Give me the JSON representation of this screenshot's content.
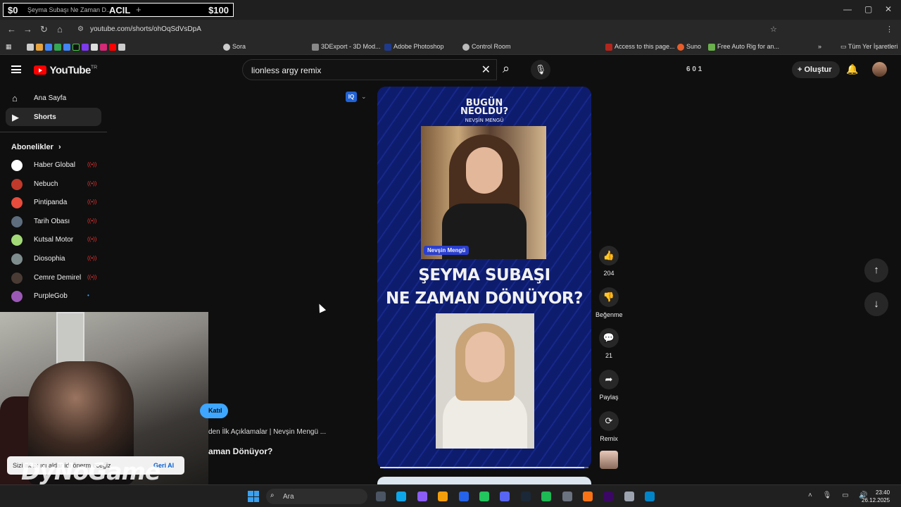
{
  "overlay_bar": {
    "left": "$0",
    "center": "ACIL",
    "right": "$100",
    "tab_title": "Şeyma Subaşı Ne Zaman D...",
    "new_tab": "+"
  },
  "window_controls": {
    "minimize": "—",
    "maximize": "▢",
    "close": "✕"
  },
  "address": {
    "url": "youtube.com/shorts/ohOqSdVsDpA",
    "back": "←",
    "forward": "→",
    "reload": "↻",
    "home": "⌂"
  },
  "bookmarks": {
    "items": [
      {
        "label": "Sora",
        "color": "#cccccc"
      },
      {
        "label": "3DExport - 3D Mod...",
        "color": "#888888"
      },
      {
        "label": "Adobe Photoshop",
        "color": "#1f3a8a"
      },
      {
        "label": "Control Room",
        "color": "#bbbbbb"
      },
      {
        "label": "Access to this page...",
        "color": "#b3261e"
      },
      {
        "label": "Suno",
        "color": "#e85d2a"
      },
      {
        "label": "Free Auto Rig for an...",
        "color": "#6ab04c"
      }
    ],
    "all_bookmarks": "Tüm Yer İşaretleri",
    "more": "»"
  },
  "header": {
    "logo": "YouTube",
    "logo_country": "TR",
    "search_value": "lionless argy remix",
    "clear": "✕",
    "search_icon": "⌕",
    "mic_icon": "🎙",
    "counters": "6   0   1",
    "create_label": "Oluştur",
    "create_plus": "+",
    "bell": "🔔"
  },
  "sidebar": {
    "home": {
      "label": "Ana Sayfa",
      "icon": "⌂"
    },
    "shorts": {
      "label": "Shorts",
      "icon": "▶"
    },
    "subscriptions_title": "Abonelikler",
    "subscriptions_chevron": "›",
    "subscriptions": [
      {
        "name": "Haber Global",
        "live": "((•))",
        "color": "#ffffff"
      },
      {
        "name": "Nebuch",
        "live": "((•))",
        "color": "#c0392b"
      },
      {
        "name": "Pintipanda",
        "live": "((•))",
        "color": "#e74c3c"
      },
      {
        "name": "Tarih Obası",
        "live": "((•))",
        "color": "#5d6d7e"
      },
      {
        "name": "Kutsal Motor",
        "live": "((•))",
        "color": "#a3d977"
      },
      {
        "name": "Diosophia",
        "live": "((•))",
        "color": "#7f8c8d"
      },
      {
        "name": "Cemre Demirel",
        "live": "((•))",
        "color": "#4a3b35"
      },
      {
        "name": "PurpleGob",
        "live": "•",
        "color": "#9b59b6"
      }
    ]
  },
  "short": {
    "iq_badge": "IQ",
    "iq_chevron": "⌄",
    "logo_line1": "BUGÜN",
    "logo_line2": "NEOLDU?",
    "logo_sub": "NEVŞİN MENGÜ",
    "name_tag": "Nevşin Mengü",
    "headline_line1": "ŞEYMA SUBAŞI",
    "headline_line2": "NE ZAMAN DÖNÜYOR?",
    "progress": 0.98
  },
  "actions": {
    "like": {
      "icon": "👍",
      "label": "204"
    },
    "dislike": {
      "icon": "👎",
      "label": "Beğenme"
    },
    "comments": {
      "icon": "💬",
      "label": "21"
    },
    "share": {
      "icon": "➦",
      "label": "Paylaş"
    },
    "remix": {
      "icon": "⟳",
      "label": "Remix"
    }
  },
  "nav_arrows": {
    "up": "↑",
    "down": "↓"
  },
  "overlay": {
    "join": "Katıl",
    "title_line1": "den İlk Açıklamalar | Nevşin Mengü ...",
    "title_line2": "aman Dönüyor?",
    "toast_msg": "Sizi   ak bı   ıcı  aldar   idı   önerm   eceğiz",
    "toast_undo": "Geri Al",
    "watermark": "DyNoGame"
  },
  "taskbar": {
    "search_label": "Ara",
    "search_icon": "⌕",
    "tray": "˄ 🎙 ▭ 🔊",
    "time": "23:40",
    "date": "26.12.2025",
    "apps": [
      "#4b5563",
      "#0ea5e9",
      "#8b5cf6",
      "#f59e0b",
      "#2563eb",
      "#22c55e",
      "#5865f2",
      "#1b2838",
      "#1db954",
      "#6b7280",
      "#f97316",
      "#3b0764",
      "#9ca3af",
      "#0284c7"
    ]
  }
}
